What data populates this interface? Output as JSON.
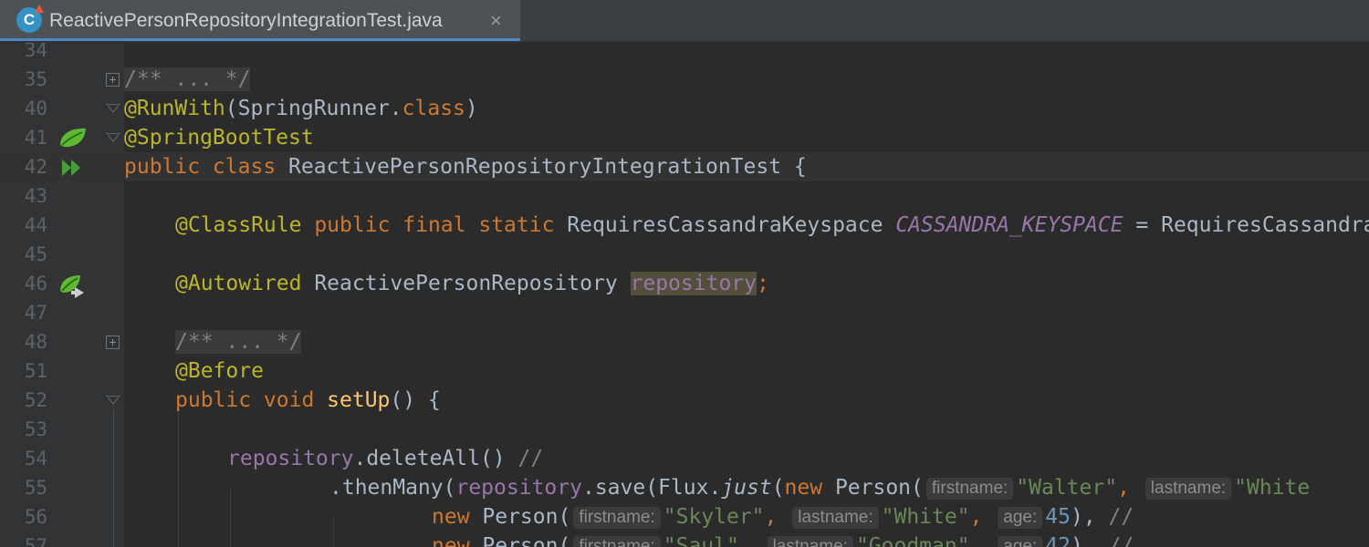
{
  "tab": {
    "title": "ReactivePersonRepositoryIntegrationTest.java",
    "icon_letter": "C",
    "close": "×"
  },
  "line_numbers": [
    "34",
    "35",
    "40",
    "41",
    "42",
    "43",
    "44",
    "45",
    "46",
    "47",
    "48",
    "51",
    "52",
    "53",
    "54",
    "55",
    "56",
    "57"
  ],
  "code": {
    "l35": {
      "folded": "/** ... */"
    },
    "l40": {
      "ann": "@RunWith",
      "p1": "(SpringRunner.",
      "kw": "class",
      "p2": ")"
    },
    "l41": {
      "ann": "@SpringBootTest"
    },
    "l42": {
      "kw": "public class ",
      "name": "ReactivePersonRepositoryIntegrationTest",
      "p": " {"
    },
    "l44": {
      "ann": "@ClassRule",
      "kw": " public final static ",
      "type": "RequiresCassandraKeyspace ",
      "const": "CASSANDRA_KEYSPACE",
      "rest": " = RequiresCassandra"
    },
    "l46": {
      "ann": "@Autowired",
      "type": " ReactivePersonRepository ",
      "field": "repository",
      "semi": ";"
    },
    "l48": {
      "folded": "/** ... */"
    },
    "l51": {
      "ann": "@Before"
    },
    "l52": {
      "kw": "public void ",
      "fn": "setUp",
      "p": "() {"
    },
    "l54": {
      "field": "repository",
      "call": ".deleteAll() ",
      "cmt": "//"
    },
    "l55": {
      "p1": ".thenMany(",
      "field": "repository",
      "p2": ".save(Flux.",
      "static": "just",
      "p3": "(",
      "kw": "new",
      "type": " Person(",
      "h1": "firstname:",
      "s1": "\"Walter\"",
      "c1": ",",
      "h2": "lastname:",
      "s2": "\"White"
    },
    "l56": {
      "kw": "new",
      "type": " Person(",
      "h1": "firstname:",
      "s1": "\"Skyler\"",
      "c1": ",",
      "h2": "lastname:",
      "s2": "\"White\"",
      "c2": ",",
      "h3": "age:",
      "n": "45",
      "p": "), ",
      "cmt": "//"
    },
    "l57": {
      "kw": "new",
      "type": " Person(",
      "h1": "firstname:",
      "s1": "\"Saul\"",
      "c1": ",",
      "h2": "lastname:",
      "s2": "\"Goodman\"",
      "c2": ",",
      "h3": "age:",
      "n": "42",
      "p": "), ",
      "cmt": "//"
    }
  },
  "colors": {
    "background": "#2b2b2b",
    "gutter": "#313335",
    "keyword": "#cc7832",
    "annotation": "#bbb529",
    "field": "#9876aa",
    "string": "#6a8759",
    "number": "#6897bb",
    "method": "#ffc66d",
    "tab_accent": "#4a88c7"
  },
  "gutter_icons": {
    "l41": "spring-bean-icon",
    "l42": "run-test-icon",
    "l46": "autowired-navigate-icon"
  }
}
